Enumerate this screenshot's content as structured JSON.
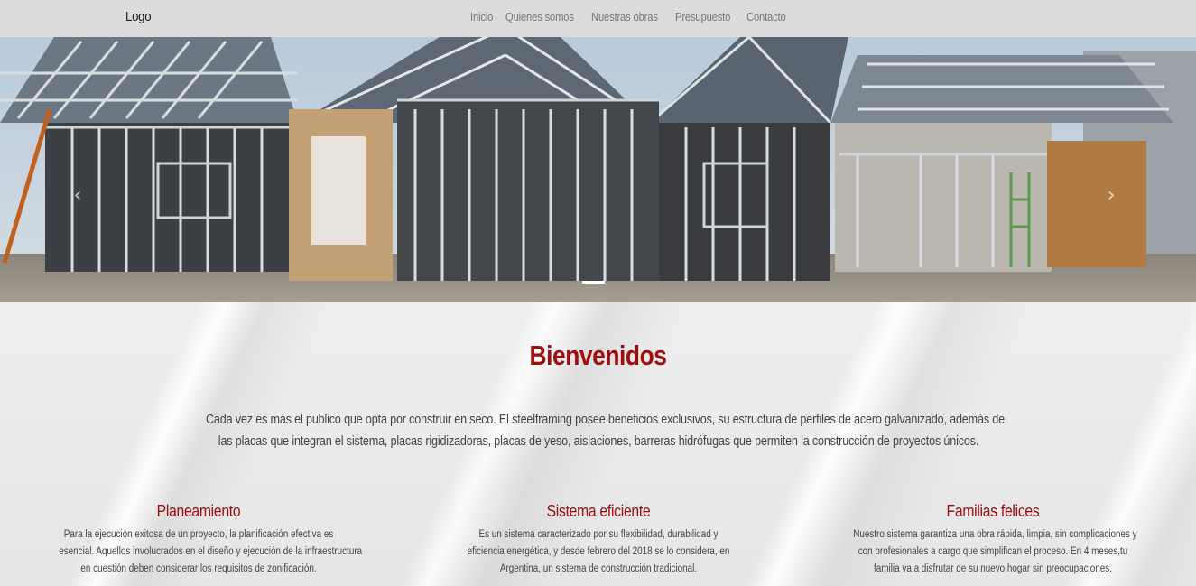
{
  "navbar": {
    "logo": "Logo",
    "links": [
      "Inicio",
      "Quienes somos",
      "Nuestras obras",
      "Presupuesto",
      "Contacto"
    ]
  },
  "hero": {
    "image_subject": "steel-frame house under construction",
    "prev_icon": "chevron-left-icon",
    "next_icon": "chevron-right-icon",
    "arrow_prev": "‹",
    "arrow_next": "›"
  },
  "welcome": {
    "title": "Bienvenidos",
    "intro_line1": "Cada vez es más el publico que opta por construir en seco. El steelframing posee beneficios exclusivos, su estructura de perfiles de acero galvanizado, además de",
    "intro_line2": "las placas que integran el sistema, placas rigidizadoras, placas de yeso, aislaciones, barreras hidrófugas que permiten la construcción de proyectos únicos."
  },
  "features": [
    {
      "title": "Planeamiento",
      "lines": [
        "Para la ejecución exitosa de un proyecto, la planificación efectiva es",
        "esencial. Aquellos involucrados en el diseño y ejecución de la infraestructura",
        "en cuestión deben considerar los requisitos de zonificación."
      ]
    },
    {
      "title": "Sistema eficiente",
      "lines": [
        "Es un sistema caracterizado por su flexibilidad, durabilidad y",
        "eficiencia energética, y desde febrero del 2018 se lo considera, en",
        "Argentina, un sistema de construcción tradicional."
      ]
    },
    {
      "title": "Familias felices",
      "lines": [
        "Nuestro sistema garantiza una obra rápida, limpia, sin complicaciones y",
        "con profesionales a cargo que simplifican el proceso. En 4 meses,tu",
        "familia va a disfrutar de su nuevo hogar sin preocupaciones."
      ]
    }
  ],
  "colors": {
    "accent": "#a10d0d",
    "navbar_bg": "#dcdcdc",
    "text": "#444444"
  }
}
